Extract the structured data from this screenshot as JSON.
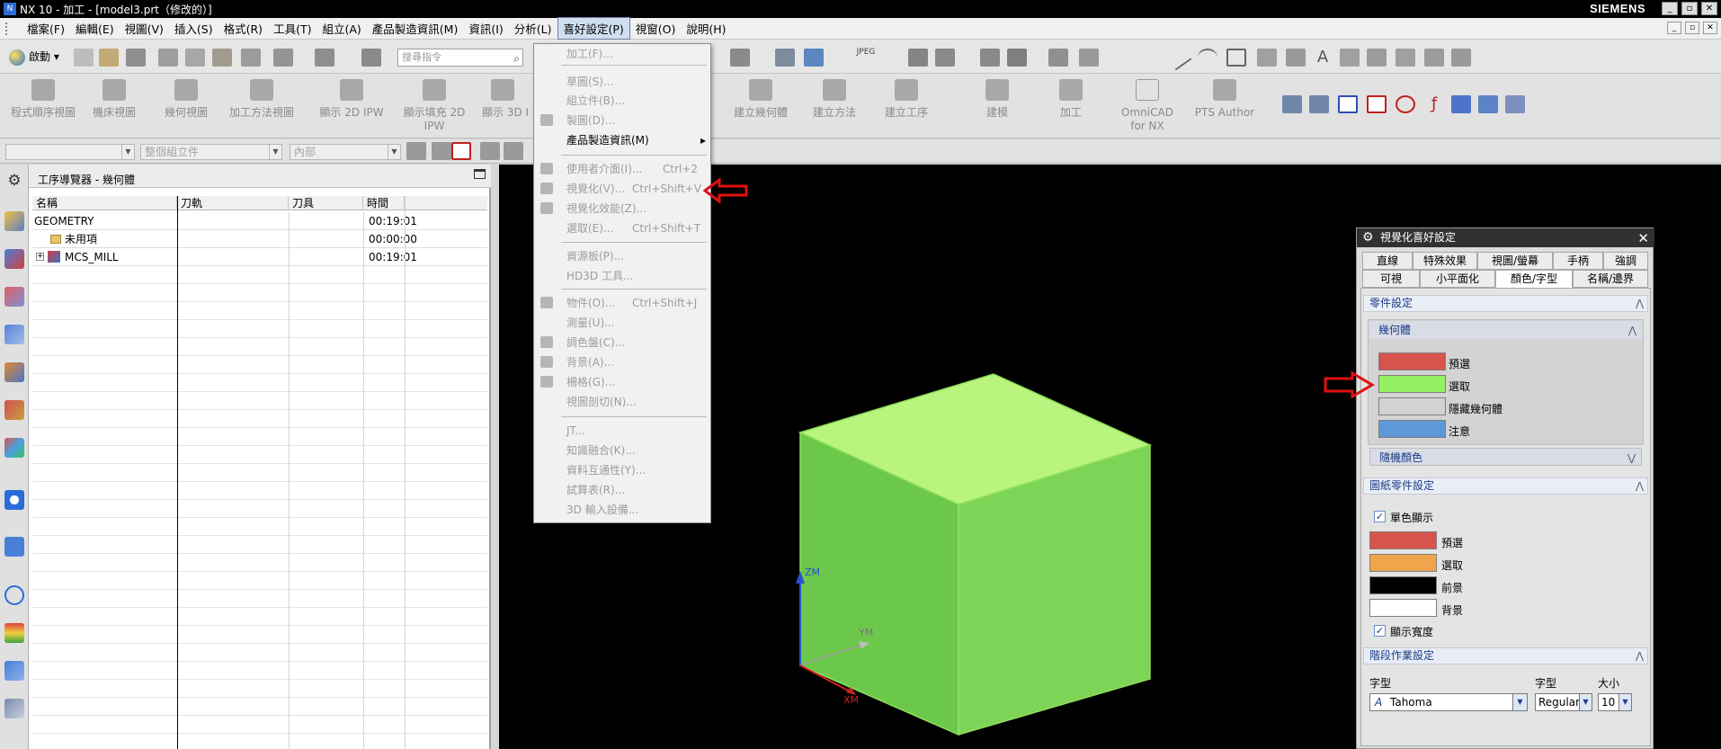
{
  "window": {
    "title": "NX 10 - 加工 - [model3.prt（修改的）]",
    "brand": "SIEMENS",
    "controls": [
      "_",
      "▫",
      "✕"
    ]
  },
  "menubar": {
    "items": [
      "檔案(F)",
      "編輯(E)",
      "視圖(V)",
      "插入(S)",
      "格式(R)",
      "工具(T)",
      "組立(A)",
      "產品製造資訊(M)",
      "資訊(I)",
      "分析(L)",
      "喜好設定(P)",
      "視窗(O)",
      "說明(H)"
    ],
    "active_index": 10
  },
  "toolbar": {
    "start_label": "啟動",
    "search_placeholder": "搜尋指令",
    "jpeg_label": "JPEG"
  },
  "ribbon": {
    "buttons": [
      "程式順序視圖",
      "機床視圖",
      "幾何視圖",
      "加工方法視圖",
      "顯示 2D IPW",
      "顯示填充 2D IPW",
      "顯示 3D I",
      "建立幾何體",
      "建立方法",
      "建立工序",
      "建模",
      "加工",
      "OmniCAD for NX",
      "PTS Author"
    ]
  },
  "filterbar": {
    "combo2": "整個組立件",
    "combo3": "內部"
  },
  "navigator": {
    "title": "工序導覽器 - 幾何體",
    "columns": [
      "名稱",
      "刀軌",
      "刀具",
      "時間"
    ],
    "rows": [
      {
        "name": "GEOMETRY",
        "time": "00:19:01"
      },
      {
        "name": "未用項",
        "time": "00:00:00"
      },
      {
        "name": "MCS_MILL",
        "time": "00:19:01"
      }
    ],
    "expander": "+"
  },
  "dropdown": {
    "items": [
      {
        "label": "加工(F)...",
        "shortcut": "",
        "enabled": false
      },
      {
        "label": "草圖(S)...",
        "shortcut": "",
        "enabled": false
      },
      {
        "label": "組立件(B)...",
        "shortcut": "",
        "enabled": false
      },
      {
        "label": "製圖(D)...",
        "shortcut": "",
        "enabled": false
      },
      {
        "label": "產品製造資訊(M)",
        "shortcut": "",
        "enabled": true
      },
      {
        "label": "使用者介面(I)...",
        "shortcut": "Ctrl+2",
        "enabled": false
      },
      {
        "label": "視覺化(V)...",
        "shortcut": "Ctrl+Shift+V",
        "enabled": false
      },
      {
        "label": "視覺化效能(Z)...",
        "shortcut": "",
        "enabled": false
      },
      {
        "label": "選取(E)...",
        "shortcut": "Ctrl+Shift+T",
        "enabled": false
      },
      {
        "label": "資源板(P)...",
        "shortcut": "",
        "enabled": false
      },
      {
        "label": "HD3D 工具...",
        "shortcut": "",
        "enabled": false
      },
      {
        "label": "物件(O)...",
        "shortcut": "Ctrl+Shift+J",
        "enabled": false
      },
      {
        "label": "測量(U)...",
        "shortcut": "",
        "enabled": false
      },
      {
        "label": "調色盤(C)...",
        "shortcut": "",
        "enabled": false
      },
      {
        "label": "背景(A)...",
        "shortcut": "",
        "enabled": false
      },
      {
        "label": "柵格(G)...",
        "shortcut": "",
        "enabled": false
      },
      {
        "label": "視圖剖切(N)...",
        "shortcut": "",
        "enabled": false
      },
      {
        "label": "JT...",
        "shortcut": "",
        "enabled": false
      },
      {
        "label": "知識融合(K)...",
        "shortcut": "",
        "enabled": false
      },
      {
        "label": "資料互通性(Y)...",
        "shortcut": "",
        "enabled": false
      },
      {
        "label": "試算表(R)...",
        "shortcut": "",
        "enabled": false
      },
      {
        "label": "3D 輸入設備...",
        "shortcut": "",
        "enabled": false
      }
    ],
    "submenu_arrow": "▸"
  },
  "viewport": {
    "axis_labels": {
      "zm": "ZM",
      "ym": "YM",
      "xm": "XM"
    },
    "cube_color": "#86d85a"
  },
  "prefs": {
    "title": "視覺化喜好設定",
    "tabs_row1": [
      "直線",
      "特殊效果",
      "視圖/螢幕",
      "手柄",
      "強調"
    ],
    "tabs_row2": [
      "可視",
      "小平面化",
      "顏色/字型",
      "名稱/邊界"
    ],
    "selected_tab": "顏色/字型",
    "sections": {
      "part": "零件設定",
      "geometry": "幾何體",
      "random": "隨機顏色",
      "drawing": "圖紙零件設定",
      "stage": "階段作業設定"
    },
    "part_colors": [
      {
        "label": "預選",
        "color": "#d6544c"
      },
      {
        "label": "選取",
        "color": "#94f060"
      },
      {
        "label": "隱藏幾何體",
        "color": "#d3d3d3"
      },
      {
        "label": "注意",
        "color": "#5e98d6"
      }
    ],
    "mono_label": "單色顯示",
    "drawing_colors": [
      {
        "label": "預選",
        "color": "#d6544c"
      },
      {
        "label": "選取",
        "color": "#f0a44c"
      },
      {
        "label": "前景",
        "color": "#000000"
      },
      {
        "label": "背景",
        "color": "#ffffff"
      }
    ],
    "width_label": "顯示寬度",
    "font": {
      "label": "字型",
      "value": "Tahoma",
      "style_label": "字型",
      "style_value": "Regular",
      "size_label": "大小",
      "size_value": "10"
    }
  },
  "annotations": {
    "arrow_color": "#e01010"
  }
}
